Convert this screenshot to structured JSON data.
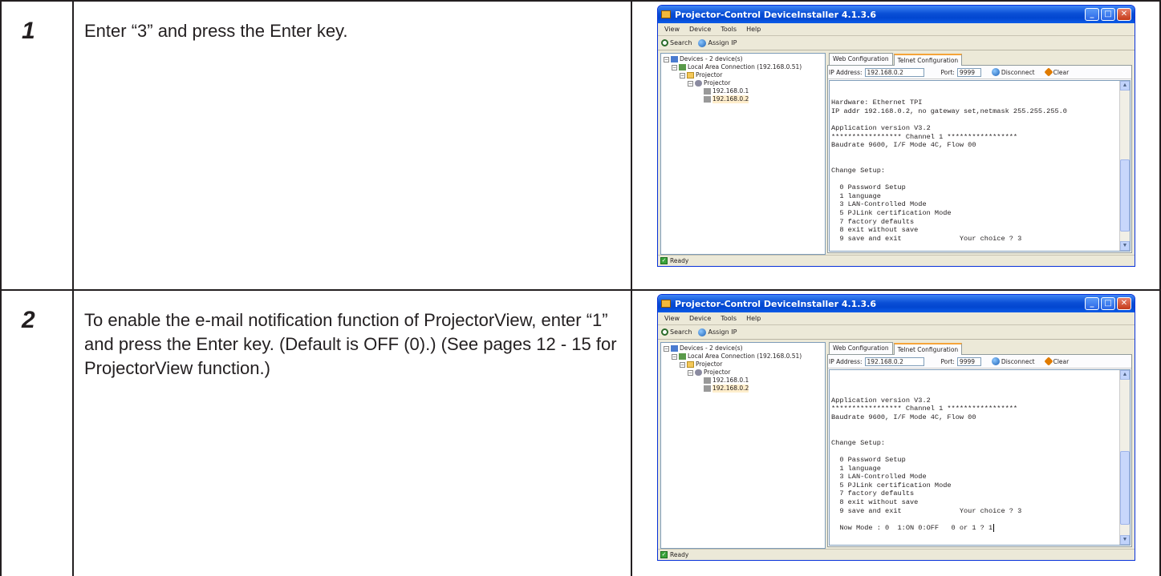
{
  "steps": [
    {
      "number": "1",
      "text": "Enter “3” and press the Enter key.",
      "window": {
        "title": "Projector-Control DeviceInstaller 4.1.3.6",
        "menu": [
          "View",
          "Device",
          "Tools",
          "Help"
        ],
        "toolbar": {
          "search": "Search",
          "assign_ip": "Assign IP"
        },
        "tree": {
          "devices": "Devices - 2 device(s)",
          "connection": "Local Area Connection (192.168.0.51)",
          "folder": "Projector",
          "group": "Projector",
          "items": [
            "192.168.0.1",
            "192.168.0.2"
          ]
        },
        "tabs": [
          "Web Configuration",
          "Telnet Configuration"
        ],
        "ip_label": "IP Address:",
        "ip_value": "192.168.0.2",
        "port_label": "Port:",
        "port_value": "9999",
        "disconnect": "Disconnect",
        "clear": "Clear",
        "terminal": [
          "Hardware: Ethernet TPI",
          "IP addr 192.168.0.2, no gateway set,netmask 255.255.255.0",
          "",
          "Application version V3.2",
          "***************** Channel 1 *****************",
          "Baudrate 9600, I/F Mode 4C, Flow 00",
          "",
          "",
          "Change Setup:",
          "",
          "  0 Password Setup",
          "  1 language",
          "  3 LAN-Controlled Mode",
          "  5 PJLink certification Mode",
          "  7 factory defaults",
          "  8 exit without save",
          "  9 save and exit              Your choice ? 3"
        ],
        "status": "Ready"
      }
    },
    {
      "number": "2",
      "text": "To enable the e-mail notification function of ProjectorView, enter “1” and press the Enter key. (Default is OFF (0).) (See pages 12 - 15 for ProjectorView function.)",
      "window": {
        "title": "Projector-Control DeviceInstaller 4.1.3.6",
        "menu": [
          "View",
          "Device",
          "Tools",
          "Help"
        ],
        "toolbar": {
          "search": "Search",
          "assign_ip": "Assign IP"
        },
        "tree": {
          "devices": "Devices - 2 device(s)",
          "connection": "Local Area Connection (192.168.0.51)",
          "folder": "Projector",
          "group": "Projector",
          "items": [
            "192.168.0.1",
            "192.168.0.2"
          ]
        },
        "tabs": [
          "Web Configuration",
          "Telnet Configuration"
        ],
        "ip_label": "IP Address:",
        "ip_value": "192.168.0.2",
        "port_label": "Port:",
        "port_value": "9999",
        "disconnect": "Disconnect",
        "clear": "Clear",
        "terminal": [
          "",
          "Application version V3.2",
          "***************** Channel 1 *****************",
          "Baudrate 9600, I/F Mode 4C, Flow 00",
          "",
          "",
          "Change Setup:",
          "",
          "  0 Password Setup",
          "  1 language",
          "  3 LAN-Controlled Mode",
          "  5 PJLink certification Mode",
          "  7 factory defaults",
          "  8 exit without save",
          "  9 save and exit              Your choice ? 3",
          "",
          "  Now Mode : 0  1:ON 0:OFF   0 or 1 ? 1"
        ],
        "status": "Ready"
      }
    }
  ]
}
